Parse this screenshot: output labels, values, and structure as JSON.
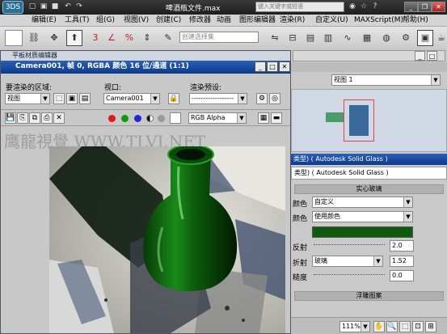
{
  "app": {
    "doc_title": "啤酒瓶文件.max",
    "search_placeholder": "键入关键字或短语",
    "logo": "3DS"
  },
  "menu": [
    "编辑(E)",
    "工具(T)",
    "组(G)",
    "视图(V)",
    "创建(C)",
    "修改器",
    "动画",
    "图形编辑器",
    "渲染(R)",
    "自定义(U)",
    "MAXScript(M)",
    "帮助(H)"
  ],
  "toolbar": {
    "selection_set_placeholder": "创建选择集"
  },
  "float_window": {
    "title": "平板材质编辑器",
    "caption": "Camera001, 帧 0, RGBA 颜色 16 位/通道 (1:1)",
    "area_label": "要渲染的区域:",
    "area_value": "视图",
    "viewport_label": "视口:",
    "viewport_value": "Camera001",
    "preset_label": "渲染预设:",
    "preset_value": "------------------",
    "channel_value": "RGB Alpha",
    "watermark": "鹰龍視覺 WWW.TLVI.NET"
  },
  "right_panel": {
    "viewport_label": "视图 1",
    "class_header": "类型) ( Autodesk Solid Glass )",
    "section_title": "实心玻璃",
    "color_label": "颜色",
    "color_value": "自定义",
    "color2_label": "颜色",
    "color2_value": "使用颜色",
    "swatch_color": "#0d5a10",
    "reflect_label": "反射",
    "reflect_value": "2.0",
    "refract_label": "折射",
    "refract_type": "玻璃",
    "refract_value": "1.52",
    "rough_label": "糙度",
    "rough_value": "0.0",
    "bottom_button": "浮雕图案",
    "zoom": "111%"
  }
}
